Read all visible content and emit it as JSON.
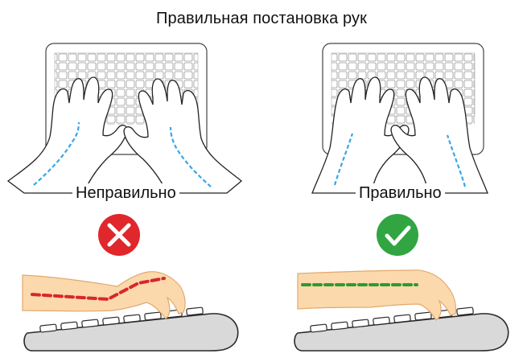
{
  "title": "Правильная постановка рук",
  "panels": {
    "wrong": {
      "label": "Неправильно",
      "indicator_icon": "cross-icon",
      "indicator_color": "#e0272b",
      "line_color": "#d9262a"
    },
    "right": {
      "label": "Правильно",
      "indicator_icon": "check-icon",
      "indicator_color": "#31a541",
      "line_color": "#2f9a2f"
    }
  },
  "colors": {
    "skin": "#fbd9ad",
    "skin_outline": "#e2a86c",
    "guide_line": "#35a7e8",
    "keyboard": "#d9d9d9",
    "outline": "#2a2a2a"
  }
}
